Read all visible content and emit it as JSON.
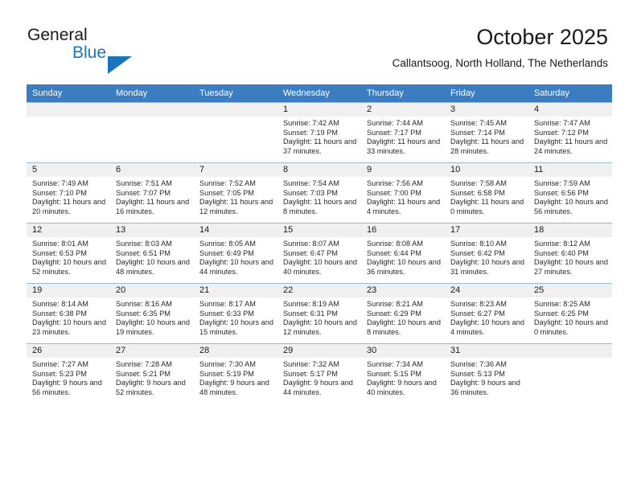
{
  "branding": {
    "name_part1": "General",
    "name_part2": "Blue",
    "accent_color": "#1b75bb"
  },
  "header": {
    "title": "October 2025",
    "subtitle": "Callantsoog, North Holland, The Netherlands"
  },
  "theme": {
    "header_row_color": "#3b7dc0",
    "daynum_band_color": "#f0f0f0",
    "grid_line_color": "#9cb8d8"
  },
  "weekdays": [
    "Sunday",
    "Monday",
    "Tuesday",
    "Wednesday",
    "Thursday",
    "Friday",
    "Saturday"
  ],
  "weeks": [
    [
      {
        "day": "",
        "sunrise": "",
        "sunset": "",
        "daylight": "",
        "empty": true
      },
      {
        "day": "",
        "sunrise": "",
        "sunset": "",
        "daylight": "",
        "empty": true
      },
      {
        "day": "",
        "sunrise": "",
        "sunset": "",
        "daylight": "",
        "empty": true
      },
      {
        "day": "1",
        "sunrise": "Sunrise: 7:42 AM",
        "sunset": "Sunset: 7:19 PM",
        "daylight": "Daylight: 11 hours and 37 minutes."
      },
      {
        "day": "2",
        "sunrise": "Sunrise: 7:44 AM",
        "sunset": "Sunset: 7:17 PM",
        "daylight": "Daylight: 11 hours and 33 minutes."
      },
      {
        "day": "3",
        "sunrise": "Sunrise: 7:45 AM",
        "sunset": "Sunset: 7:14 PM",
        "daylight": "Daylight: 11 hours and 28 minutes."
      },
      {
        "day": "4",
        "sunrise": "Sunrise: 7:47 AM",
        "sunset": "Sunset: 7:12 PM",
        "daylight": "Daylight: 11 hours and 24 minutes."
      }
    ],
    [
      {
        "day": "5",
        "sunrise": "Sunrise: 7:49 AM",
        "sunset": "Sunset: 7:10 PM",
        "daylight": "Daylight: 11 hours and 20 minutes."
      },
      {
        "day": "6",
        "sunrise": "Sunrise: 7:51 AM",
        "sunset": "Sunset: 7:07 PM",
        "daylight": "Daylight: 11 hours and 16 minutes."
      },
      {
        "day": "7",
        "sunrise": "Sunrise: 7:52 AM",
        "sunset": "Sunset: 7:05 PM",
        "daylight": "Daylight: 11 hours and 12 minutes."
      },
      {
        "day": "8",
        "sunrise": "Sunrise: 7:54 AM",
        "sunset": "Sunset: 7:03 PM",
        "daylight": "Daylight: 11 hours and 8 minutes."
      },
      {
        "day": "9",
        "sunrise": "Sunrise: 7:56 AM",
        "sunset": "Sunset: 7:00 PM",
        "daylight": "Daylight: 11 hours and 4 minutes."
      },
      {
        "day": "10",
        "sunrise": "Sunrise: 7:58 AM",
        "sunset": "Sunset: 6:58 PM",
        "daylight": "Daylight: 11 hours and 0 minutes."
      },
      {
        "day": "11",
        "sunrise": "Sunrise: 7:59 AM",
        "sunset": "Sunset: 6:56 PM",
        "daylight": "Daylight: 10 hours and 56 minutes."
      }
    ],
    [
      {
        "day": "12",
        "sunrise": "Sunrise: 8:01 AM",
        "sunset": "Sunset: 6:53 PM",
        "daylight": "Daylight: 10 hours and 52 minutes."
      },
      {
        "day": "13",
        "sunrise": "Sunrise: 8:03 AM",
        "sunset": "Sunset: 6:51 PM",
        "daylight": "Daylight: 10 hours and 48 minutes."
      },
      {
        "day": "14",
        "sunrise": "Sunrise: 8:05 AM",
        "sunset": "Sunset: 6:49 PM",
        "daylight": "Daylight: 10 hours and 44 minutes."
      },
      {
        "day": "15",
        "sunrise": "Sunrise: 8:07 AM",
        "sunset": "Sunset: 6:47 PM",
        "daylight": "Daylight: 10 hours and 40 minutes."
      },
      {
        "day": "16",
        "sunrise": "Sunrise: 8:08 AM",
        "sunset": "Sunset: 6:44 PM",
        "daylight": "Daylight: 10 hours and 36 minutes."
      },
      {
        "day": "17",
        "sunrise": "Sunrise: 8:10 AM",
        "sunset": "Sunset: 6:42 PM",
        "daylight": "Daylight: 10 hours and 31 minutes."
      },
      {
        "day": "18",
        "sunrise": "Sunrise: 8:12 AM",
        "sunset": "Sunset: 6:40 PM",
        "daylight": "Daylight: 10 hours and 27 minutes."
      }
    ],
    [
      {
        "day": "19",
        "sunrise": "Sunrise: 8:14 AM",
        "sunset": "Sunset: 6:38 PM",
        "daylight": "Daylight: 10 hours and 23 minutes."
      },
      {
        "day": "20",
        "sunrise": "Sunrise: 8:16 AM",
        "sunset": "Sunset: 6:35 PM",
        "daylight": "Daylight: 10 hours and 19 minutes."
      },
      {
        "day": "21",
        "sunrise": "Sunrise: 8:17 AM",
        "sunset": "Sunset: 6:33 PM",
        "daylight": "Daylight: 10 hours and 15 minutes."
      },
      {
        "day": "22",
        "sunrise": "Sunrise: 8:19 AM",
        "sunset": "Sunset: 6:31 PM",
        "daylight": "Daylight: 10 hours and 12 minutes."
      },
      {
        "day": "23",
        "sunrise": "Sunrise: 8:21 AM",
        "sunset": "Sunset: 6:29 PM",
        "daylight": "Daylight: 10 hours and 8 minutes."
      },
      {
        "day": "24",
        "sunrise": "Sunrise: 8:23 AM",
        "sunset": "Sunset: 6:27 PM",
        "daylight": "Daylight: 10 hours and 4 minutes."
      },
      {
        "day": "25",
        "sunrise": "Sunrise: 8:25 AM",
        "sunset": "Sunset: 6:25 PM",
        "daylight": "Daylight: 10 hours and 0 minutes."
      }
    ],
    [
      {
        "day": "26",
        "sunrise": "Sunrise: 7:27 AM",
        "sunset": "Sunset: 5:23 PM",
        "daylight": "Daylight: 9 hours and 56 minutes."
      },
      {
        "day": "27",
        "sunrise": "Sunrise: 7:28 AM",
        "sunset": "Sunset: 5:21 PM",
        "daylight": "Daylight: 9 hours and 52 minutes."
      },
      {
        "day": "28",
        "sunrise": "Sunrise: 7:30 AM",
        "sunset": "Sunset: 5:19 PM",
        "daylight": "Daylight: 9 hours and 48 minutes."
      },
      {
        "day": "29",
        "sunrise": "Sunrise: 7:32 AM",
        "sunset": "Sunset: 5:17 PM",
        "daylight": "Daylight: 9 hours and 44 minutes."
      },
      {
        "day": "30",
        "sunrise": "Sunrise: 7:34 AM",
        "sunset": "Sunset: 5:15 PM",
        "daylight": "Daylight: 9 hours and 40 minutes."
      },
      {
        "day": "31",
        "sunrise": "Sunrise: 7:36 AM",
        "sunset": "Sunset: 5:13 PM",
        "daylight": "Daylight: 9 hours and 36 minutes."
      },
      {
        "day": "",
        "sunrise": "",
        "sunset": "",
        "daylight": "",
        "empty": true
      }
    ]
  ]
}
